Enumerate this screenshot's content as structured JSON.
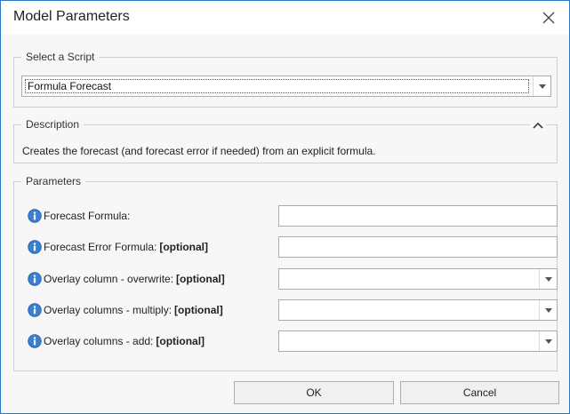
{
  "dialog": {
    "title": "Model Parameters"
  },
  "script_group": {
    "legend": "Select a Script",
    "selected": "Formula Forecast"
  },
  "description_group": {
    "legend": "Description",
    "text": "Creates the forecast (and forecast error if needed) from an explicit formula."
  },
  "parameters_group": {
    "legend": "Parameters",
    "params": [
      {
        "label": "Forecast Formula:",
        "tag": "",
        "control": "text",
        "value": ""
      },
      {
        "label": "Forecast Error Formula:",
        "tag": "[optional]",
        "control": "text",
        "value": ""
      },
      {
        "label": "Overlay column - overwrite:",
        "tag": "[optional]",
        "control": "select",
        "value": ""
      },
      {
        "label": "Overlay columns - multiply:",
        "tag": "[optional]",
        "control": "select",
        "value": ""
      },
      {
        "label": "Overlay columns - add:",
        "tag": "[optional]",
        "control": "select",
        "value": ""
      }
    ]
  },
  "buttons": {
    "ok": "OK",
    "cancel": "Cancel"
  },
  "icons": {
    "close": "close-icon",
    "dropdown": "chevron-down-icon",
    "collapse": "chevron-up-icon",
    "info": "info-icon"
  },
  "colors": {
    "window_border": "#2b78c5",
    "info_icon": "#3b7fd0"
  }
}
